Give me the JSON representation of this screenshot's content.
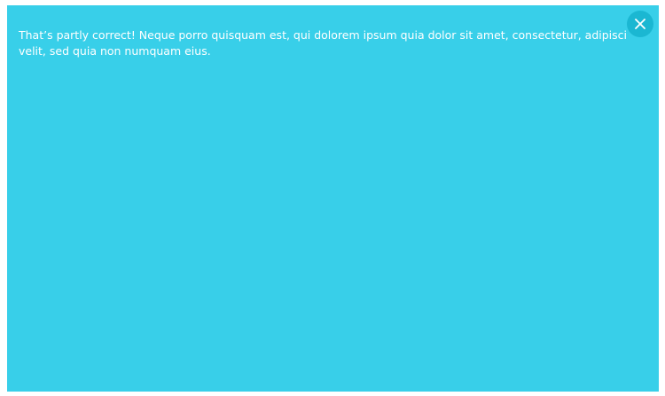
{
  "feedback": {
    "message": "That’s partly correct! Neque porro quisquam est, qui dolorem ipsum quia dolor sit amet, consectetur, adipisci velit, sed quia non numquam eius.",
    "close_icon": "close-icon"
  },
  "colors": {
    "panel_background": "#38cfe9",
    "close_button_background": "#1bb7d2",
    "text": "#ffffff"
  }
}
